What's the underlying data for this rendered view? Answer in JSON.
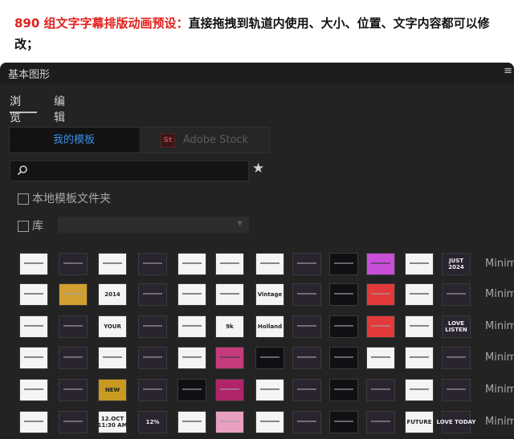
{
  "banner": {
    "number": "890",
    "headline": "组文字字幕排版动画预设：",
    "description": "直接拖拽到轨道内使用、大小、位置、文字内容都可以修改；",
    "accent_color": "#e0201c"
  },
  "panel": {
    "title": "基本图形",
    "menu_icon": "menu-icon",
    "tabs": [
      {
        "label": "浏览",
        "active": true
      },
      {
        "label": "编辑",
        "active": false
      }
    ],
    "source_toggle": {
      "my_templates": "我的模板",
      "stock_logo": "St",
      "stock": "Adobe Stock",
      "accent_color": "#3a8ee6"
    },
    "search": {
      "placeholder": "",
      "value": ""
    },
    "favorites_icon": "star-icon",
    "local_templates_label": "本地模板文件夹",
    "library_label": "库",
    "library_value": "",
    "row_labels": [
      "Minim",
      "Minim",
      "Minim",
      "Minim",
      "Minim",
      "Minim"
    ],
    "thumbnail_texts": {
      "0_8": "",
      "1_2": "2014",
      "1_6": "Vintage",
      "2_2": "YOUR",
      "2_5": "9k",
      "2_6": "Holland",
      "2_11": "LOVE\nLISTEN",
      "5_2": "12.OCT\n11:30 AM",
      "5_3": "12%",
      "0_11": "JUST\n2024",
      "4_2": "NEW",
      "5_10": "FUTURE",
      "5_11": "LOVE TODAY"
    }
  }
}
